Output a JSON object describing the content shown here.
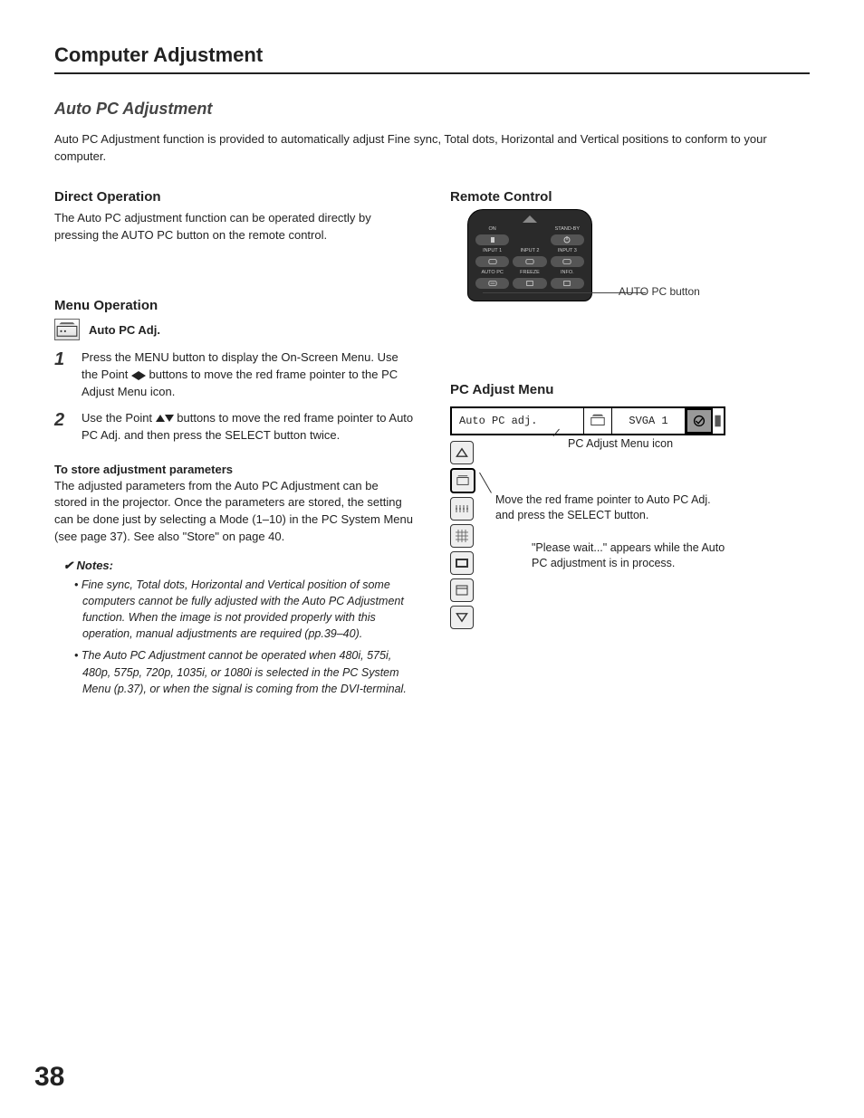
{
  "chapter": "Computer Adjustment",
  "section": "Auto PC Adjustment",
  "intro": "Auto PC Adjustment function is provided to automatically adjust Fine sync, Total dots, Horizontal and Vertical positions to conform to your computer.",
  "direct_op": {
    "heading": "Direct Operation",
    "body": "The Auto PC adjustment function can be operated directly by pressing the AUTO PC button on the remote control."
  },
  "remote": {
    "heading": "Remote Control",
    "labels": {
      "on": "ON",
      "standby": "STAND-BY",
      "input1": "INPUT 1",
      "input2": "INPUT 2",
      "input3": "INPUT 3",
      "autopc": "AUTO PC",
      "freeze": "FREEZE",
      "info": "INFO."
    },
    "callout": "AUTO PC button"
  },
  "menu_op": {
    "heading": "Menu Operation",
    "sub": "Auto PC Adj.",
    "steps": [
      "Press the MENU button to display the On-Screen Menu. Use the Point ◀▶ buttons to move the red frame pointer to the PC Adjust Menu icon.",
      "Use the Point ▲▼ buttons to move the red frame pointer to Auto PC Adj. and then press the SELECT button twice."
    ],
    "store_head": "To store adjustment parameters",
    "store_body": "The adjusted parameters from the Auto PC Adjustment can be stored in the projector. Once the parameters are stored, the setting can be done just by selecting a Mode (1–10) in the PC System Menu (see page 37). See also \"Store\" on page 40.",
    "notes_head": "Notes:",
    "notes": [
      "Fine sync, Total dots, Horizontal and Vertical position of some computers cannot be fully adjusted with the Auto PC Adjustment function. When the image is not provided properly with this operation, manual adjustments are required (pp.39–40).",
      "The Auto PC Adjustment cannot be operated when 480i, 575i, 480p, 575p, 720p, 1035i, or 1080i is selected in the PC System Menu (p.37), or when the signal is coming from the DVI-terminal."
    ]
  },
  "pcmenu": {
    "heading": "PC Adjust Menu",
    "bar_title": "Auto PC adj.",
    "bar_mode": "SVGA 1",
    "callout_icon": "PC Adjust Menu icon",
    "callout_move": "Move the red frame pointer to Auto PC Adj. and press the SELECT button.",
    "callout_wait": "\"Please wait...\" appears while the Auto PC adjustment is in process."
  },
  "page_number": "38"
}
